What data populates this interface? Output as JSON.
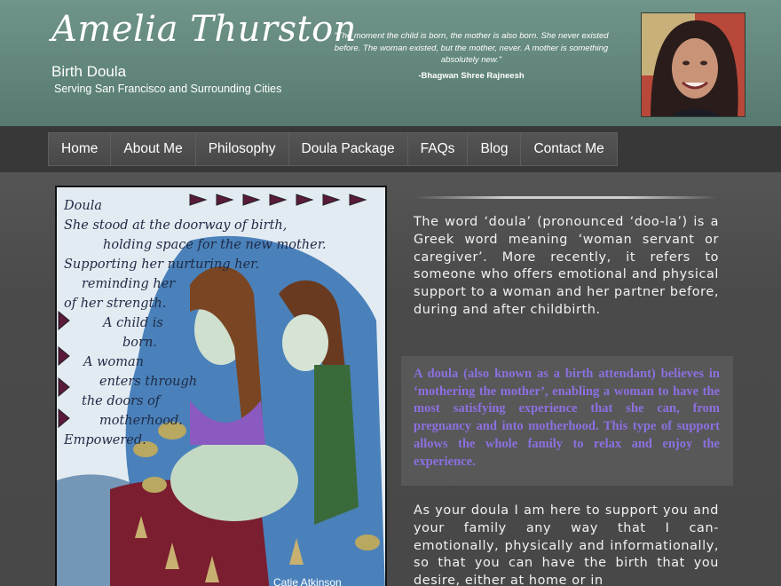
{
  "header": {
    "title": "Amelia Thurston",
    "subtitle": "Birth Doula",
    "tagline": "Serving San Francisco and Surrounding Cities",
    "quote": "\"The moment the child is born, the mother is also born. She never existed before. The woman existed, but the mother, never. A mother is something absolutely new.\"",
    "quote_author": "-Bhagwan Shree Rajneesh"
  },
  "nav": {
    "items": [
      {
        "label": "Home"
      },
      {
        "label": "About Me"
      },
      {
        "label": "Philosophy"
      },
      {
        "label": "Doula Package"
      },
      {
        "label": "FAQs"
      },
      {
        "label": "Blog"
      },
      {
        "label": "Contact Me"
      }
    ]
  },
  "artwork": {
    "text_lines": [
      "Doula",
      "She stood at the doorway of birth,",
      "holding space for the new mother.",
      "Supporting her nurturing her.",
      "reminding her",
      "of her strength.",
      "A child is",
      "born.",
      "A woman",
      "enters through",
      "the doors of",
      "motherhood.",
      "Empowered."
    ],
    "credit": "Catie Atkinson"
  },
  "content": {
    "para1": "The word ‘doula’ (pronounced ‘doo-la’) is a Greek word meaning ‘woman servant or caregiver’. More recently, it refers to someone who offers emotional and physical support to a woman and her partner before, during and after childbirth.",
    "highlight": "A doula (also known as a birth attendant) believes in ‘mothering the mother’, enabling a woman to have the most satisfying experience that she can, from pregnancy and into motherhood. This type of support allows the whole family to relax and enjoy the experience.",
    "para3": "As your doula I am here to support you and your family any way that I can- emotionally, physically and informationally, so that you can have the birth that you desire, either at home or in"
  },
  "colors": {
    "header_bg": "#6f9489",
    "nav_bg": "#383838",
    "page_bg": "#4a4a4a",
    "highlight_text": "#8c70e0"
  }
}
